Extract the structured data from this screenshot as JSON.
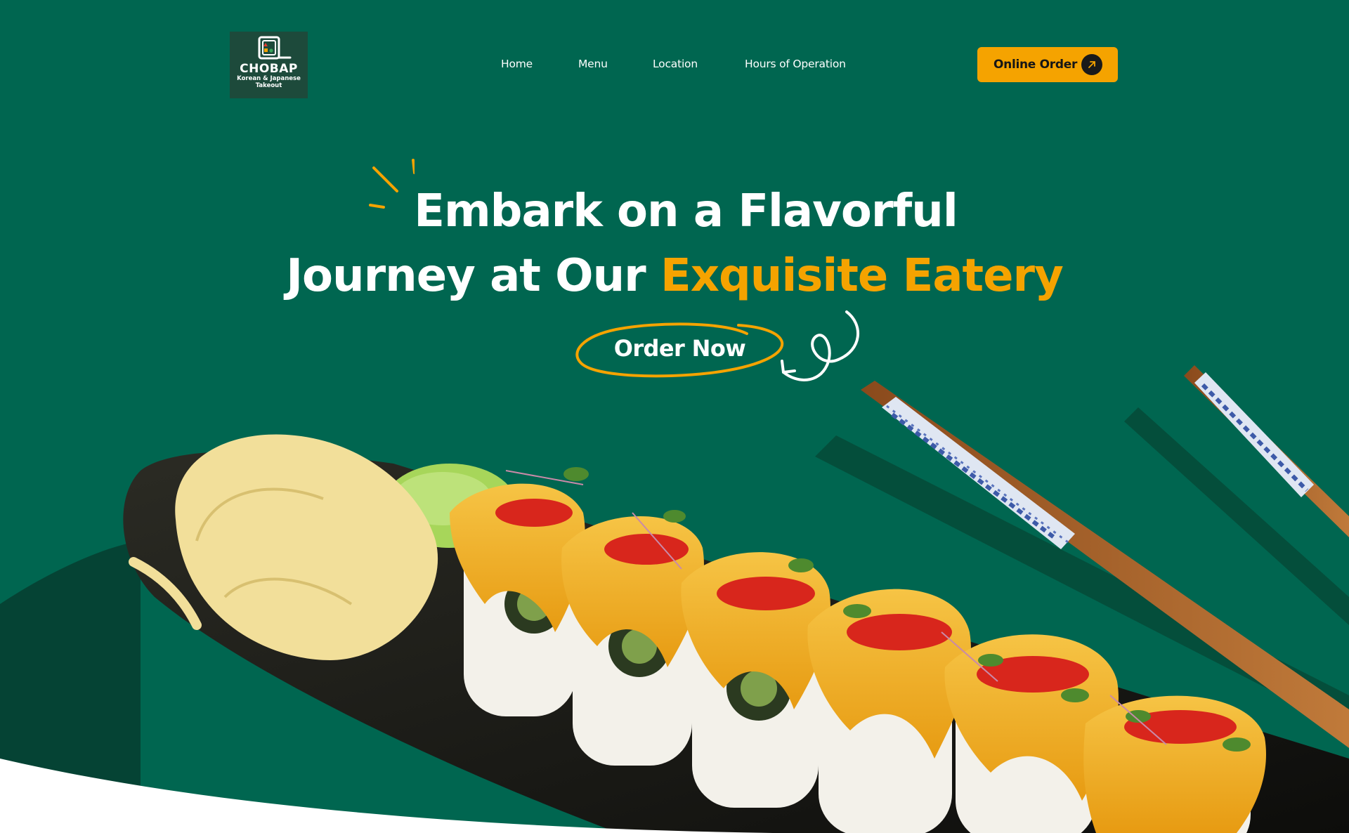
{
  "brand": {
    "name": "CHOBAP",
    "tagline": "Korean & Japanese Takeout",
    "logo_icon": "restaurant-logo-icon"
  },
  "nav": {
    "items": [
      {
        "label": "Home"
      },
      {
        "label": "Menu"
      },
      {
        "label": "Location"
      },
      {
        "label": "Hours of Operation"
      }
    ]
  },
  "header": {
    "order_button_label": "Online Order",
    "order_button_icon": "arrow-up-right-icon"
  },
  "hero": {
    "line1": "Embark on a Flavorful",
    "line2_white": "Journey at Our",
    "line2_accent": "Exquisite Eatery",
    "cta_label": "Order Now",
    "image_alt": "sushi-rolls-with-chopsticks-image"
  },
  "colors": {
    "background": "#006650",
    "accent": "#f5a300",
    "text": "#ffffff",
    "button_text": "#161616"
  }
}
